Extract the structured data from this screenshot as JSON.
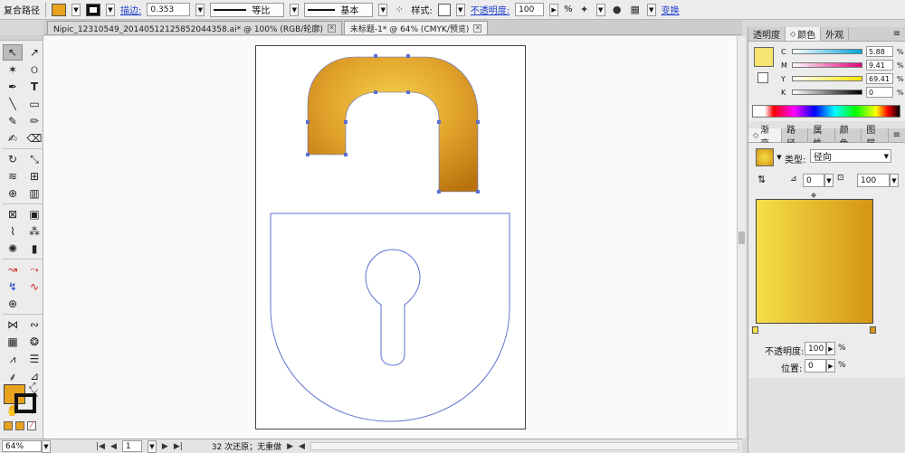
{
  "control_bar": {
    "selection_label": "复合路径",
    "stroke_label": "描边:",
    "stroke_weight": "0.353",
    "profile_label": "等比",
    "brush_label": "基本",
    "style_label": "样式:",
    "opacity_label": "不透明度:",
    "opacity_value": "100",
    "opacity_unit": "%",
    "transform_label": "变换"
  },
  "document_tabs": [
    {
      "title": "Nipic_12310549_20140512125852044358.ai* @ 100% (RGB/轮廓)"
    },
    {
      "title": "未标题-1* @ 64% (CMYK/预览)"
    }
  ],
  "status_bar": {
    "zoom": "64%",
    "page": "1",
    "history_text": "32 次还原；无重做"
  },
  "color_panel": {
    "tabs": [
      "透明度",
      "颜色",
      "外观"
    ],
    "active_tab": "颜色",
    "channels": [
      {
        "label": "C",
        "value": "5.88"
      },
      {
        "label": "M",
        "value": "9.41"
      },
      {
        "label": "Y",
        "value": "69.41"
      },
      {
        "label": "K",
        "value": "0"
      }
    ],
    "unit": "%",
    "fill_color": "#f7e36f"
  },
  "gradient_panel": {
    "tabs": [
      "渐变",
      "路径",
      "属性",
      "颜色",
      "图层"
    ],
    "active_tab": "渐变",
    "type_label": "类型:",
    "type_value": "径向",
    "angle_value": "0",
    "ratio_value": "100",
    "opacity_label": "不透明度:",
    "opacity_value": "100",
    "position_label": "位置:",
    "position_value": "0",
    "unit": "%",
    "stop_colors": [
      "#f5df4a",
      "#d59513"
    ]
  },
  "colors": {
    "fill_swatch": "#e8a21e",
    "shackle_light": "#f2c23a",
    "shackle_dark": "#c27a12",
    "outline": "#5a6fd0"
  }
}
